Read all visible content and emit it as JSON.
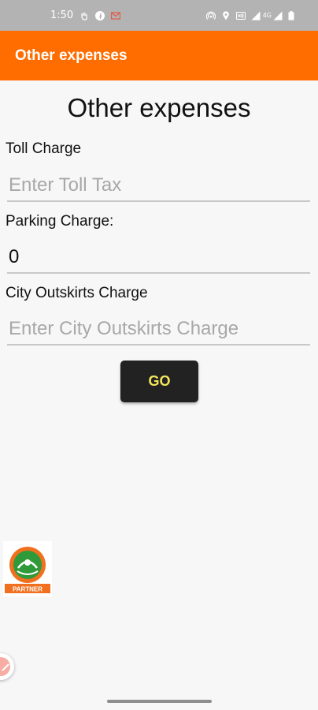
{
  "status_bar": {
    "time": "1:50",
    "network": "4G"
  },
  "app_bar": {
    "title": "Other expenses"
  },
  "page": {
    "heading": "Other expenses"
  },
  "form": {
    "toll": {
      "label": "Toll Charge",
      "placeholder": "Enter Toll Tax",
      "value": ""
    },
    "parking": {
      "label": "Parking Charge:",
      "placeholder": "",
      "value": "0"
    },
    "city": {
      "label": "City Outskirts Charge",
      "placeholder": "Enter City Outskirts Charge",
      "value": ""
    },
    "go_label": "GO"
  },
  "partner": {
    "badge_text": "PARTNER"
  },
  "colors": {
    "accent": "#ff6d00",
    "button_bg": "#222222",
    "button_text": "#f2e55c"
  }
}
